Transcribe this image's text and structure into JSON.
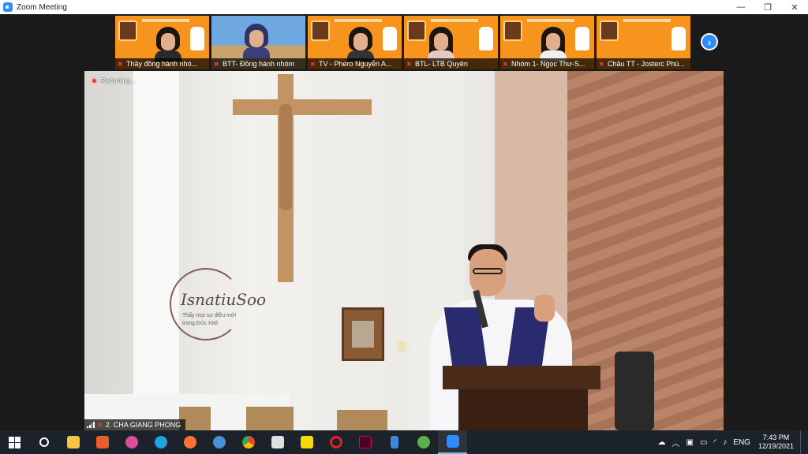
{
  "window": {
    "title": "Zoom Meeting",
    "minimize": "—",
    "restore": "❐",
    "close": "✕"
  },
  "participants": [
    {
      "name": "Thầy đồng hành nhó..."
    },
    {
      "name": "BTT- Đồng hành nhóm"
    },
    {
      "name": "TV - Phero Nguyễn A..."
    },
    {
      "name": "BTL- LTB Quyên"
    },
    {
      "name": "Nhóm 1- Ngọc Thư-S..."
    },
    {
      "name": "Châu TT - Josterc Phú..."
    }
  ],
  "next_button": "›",
  "main_video": {
    "recording_label": "Recording...",
    "speaker_name": "2. CHA GIANG PHONG",
    "wall_logo_text": "IsnatiuSoo",
    "wall_logo_sub1": "Thấy mọi sự điều mới",
    "wall_logo_sub2": "trong Đức Kitô"
  },
  "taskbar": {
    "icons": [
      "windows-start",
      "search",
      "file-explorer",
      "media-player",
      "paint",
      "edge",
      "firefox",
      "chromium",
      "chrome",
      "app-grid",
      "sticky-notes",
      "opera",
      "indesign",
      "bluetooth-app",
      "globe-app",
      "zoom"
    ],
    "colors": {
      "file-explorer": "#f4c542",
      "media-player": "#e85c2c",
      "paint": "#d94f9a",
      "edge": "#1fa2e0",
      "firefox": "#ff7139",
      "chromium": "#4a90d9",
      "chrome": "#34a853",
      "app-grid": "#e0e0e0",
      "sticky-notes": "#f5d90a",
      "opera": "#e0202e",
      "indesign": "#d6006e",
      "bluetooth-app": "#3a8ad8",
      "globe-app": "#5ab04a",
      "zoom": "#2d8cff"
    },
    "language": "ENG",
    "time": "7:43 PM",
    "date": "12/19/2021"
  }
}
